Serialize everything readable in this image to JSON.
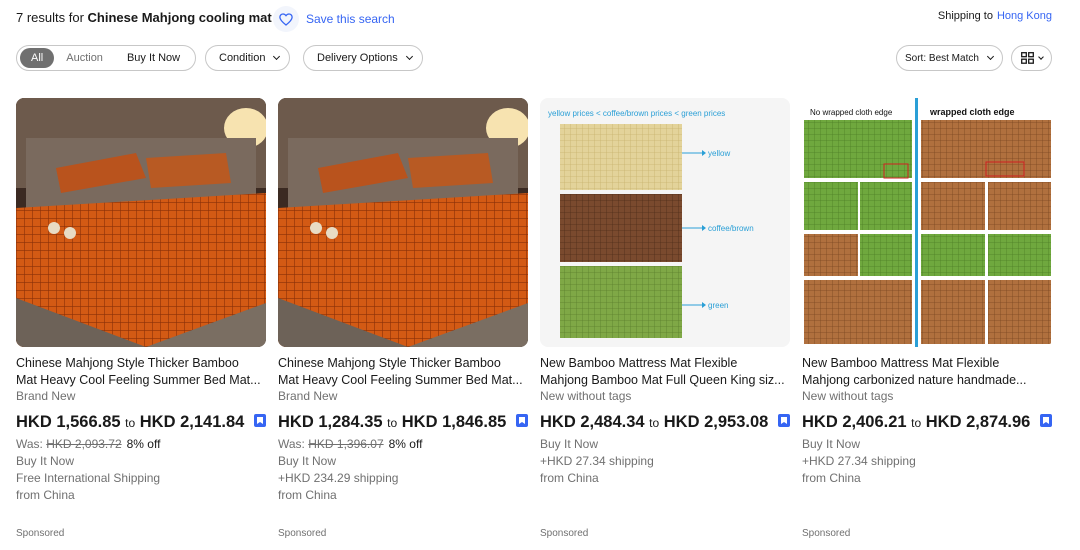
{
  "header": {
    "results_prefix": "7 results for ",
    "query": "Chinese Mahjong cooling mat",
    "save_search": "Save this search",
    "shipping_label": "Shipping to",
    "shipping_location": "Hong Kong"
  },
  "filters": {
    "all": "All",
    "auction": "Auction",
    "buy_it_now": "Buy It Now",
    "condition": "Condition",
    "delivery": "Delivery Options",
    "sort": "Sort: Best Match"
  },
  "colors": {
    "accent": "#3665f3",
    "muted": "#707070",
    "text": "#191919"
  },
  "listings": [
    {
      "title1": "Chinese Mahjong Style Thicker Bamboo",
      "title2": "Mat Heavy Cool Feeling Summer Bed Mat...",
      "condition": "Brand New",
      "price_low": "HKD 1,566.85",
      "price_to": "to",
      "price_high": "HKD 2,141.84",
      "was_label": "Was:",
      "was_price": "HKD 2,093.72",
      "discount": "8% off",
      "format": "Buy It Now",
      "shipping": "Free International Shipping",
      "origin": "from China",
      "sponsored": "Sponsored"
    },
    {
      "title1": "Chinese Mahjong Style Thicker Bamboo",
      "title2": "Mat Heavy Cool Feeling Summer Bed Mat...",
      "condition": "Brand New",
      "price_low": "HKD 1,284.35",
      "price_to": "to",
      "price_high": "HKD 1,846.85",
      "was_label": "Was:",
      "was_price": "HKD 1,396.07",
      "discount": "8% off",
      "format": "Buy It Now",
      "shipping": "+HKD 234.29 shipping",
      "origin": "from China",
      "sponsored": "Sponsored"
    },
    {
      "title1": "New Bamboo Mattress Mat Flexible",
      "title2": "Mahjong Bamboo Mat Full Queen King siz...",
      "condition": "New without tags",
      "price_low": "HKD 2,484.34",
      "price_to": "to",
      "price_high": "HKD 2,953.08",
      "format": "Buy It Now",
      "shipping": "+HKD 27.34 shipping",
      "origin": "from China",
      "sponsored": "Sponsored",
      "img_header": "yellow  prices < coffee/brown prices < green prices",
      "img_labels": [
        "yellow",
        "coffee/brown",
        "green"
      ]
    },
    {
      "title1": "New Bamboo Mattress Mat Flexible",
      "title2": "Mahjong carbonized nature handmade...",
      "condition": "New without tags",
      "price_low": "HKD 2,406.21",
      "price_to": "to",
      "price_high": "HKD 2,874.96",
      "format": "Buy It Now",
      "shipping": "+HKD 27.34 shipping",
      "origin": "from China",
      "sponsored": "Sponsored",
      "img_left_label": "No wrapped cloth edge",
      "img_right_label": "wrapped cloth edge"
    }
  ]
}
